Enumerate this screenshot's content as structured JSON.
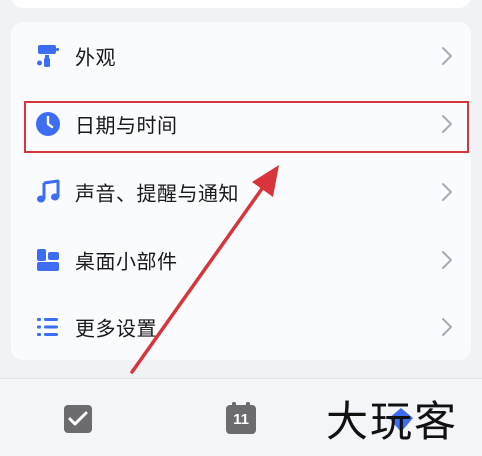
{
  "settings": {
    "items": [
      {
        "label": "外观",
        "icon": "paint-roller-icon"
      },
      {
        "label": "日期与时间",
        "icon": "clock-icon"
      },
      {
        "label": "声音、提醒与通知",
        "icon": "music-note-icon"
      },
      {
        "label": "桌面小部件",
        "icon": "widgets-icon"
      },
      {
        "label": "更多设置",
        "icon": "list-settings-icon"
      }
    ]
  },
  "tabbar": {
    "tasks_icon": "checkbox-icon",
    "calendar_day": "11",
    "calendar_icon": "calendar-icon",
    "third_icon": "tag-icon"
  },
  "watermark": {
    "text": "大玩客"
  },
  "colors": {
    "accent": "#3d6df2",
    "highlight": "#d8343c",
    "arrow": "#d8343c",
    "tab_icon": "#6b6b70"
  }
}
